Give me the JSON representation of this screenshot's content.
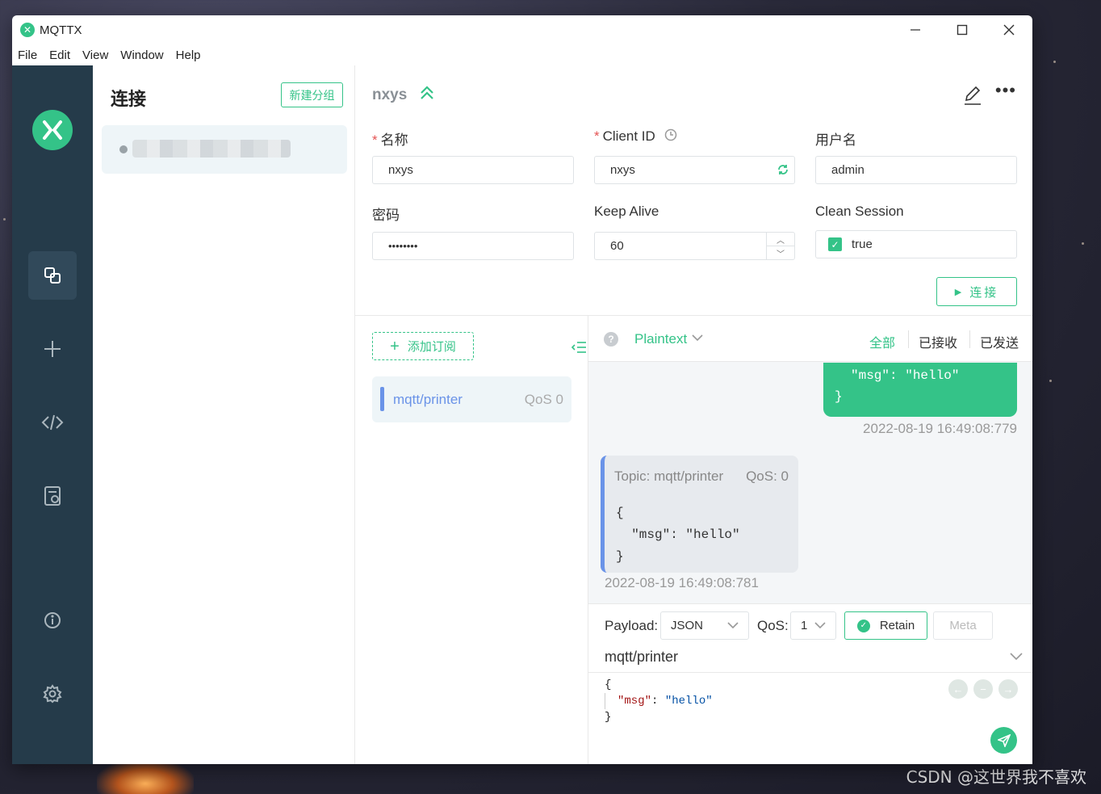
{
  "window": {
    "title": "MQTTX"
  },
  "menu": [
    "File",
    "Edit",
    "View",
    "Window",
    "Help"
  ],
  "connections": {
    "title": "连接",
    "new_group": "新建分组"
  },
  "connection": {
    "name": "nxys",
    "labels": {
      "name": "名称",
      "client_id": "Client ID",
      "username": "用户名",
      "password": "密码",
      "keep_alive": "Keep Alive",
      "clean_session": "Clean Session"
    },
    "values": {
      "name": "nxys",
      "client_id": "nxys",
      "username": "admin",
      "password": "••••••••",
      "keep_alive": "60",
      "clean_session": "true"
    },
    "connect_button": "连接"
  },
  "subscriptions": {
    "add_button": "添加订阅",
    "items": [
      {
        "topic": "mqtt/printer",
        "qos": "QoS 0",
        "color": "#6a93e8"
      }
    ]
  },
  "messages": {
    "format": "Plaintext",
    "filters": [
      "全部",
      "已接收",
      "已发送"
    ],
    "sent": {
      "line1": "\"msg\": \"hello\"",
      "line2": "}",
      "time": "2022-08-19 16:49:08:779"
    },
    "received": {
      "topic": "Topic: mqtt/printer",
      "qos": "QoS: 0",
      "payload": "{\n  \"msg\": \"hello\"\n}",
      "time": "2022-08-19 16:49:08:781"
    }
  },
  "publish": {
    "payload_label": "Payload:",
    "payload_type": "JSON",
    "qos_label": "QoS:",
    "qos": "1",
    "retain": "Retain",
    "meta": "Meta",
    "topic": "mqtt/printer",
    "body": {
      "open": "{",
      "key": "\"msg\"",
      "colon": ": ",
      "value": "\"hello\"",
      "close": "}"
    }
  },
  "watermark": "CSDN @这世界我不喜欢",
  "colors": {
    "accent": "#34c388",
    "nav_bg": "#253b4a",
    "topic": "#6a93e8"
  }
}
